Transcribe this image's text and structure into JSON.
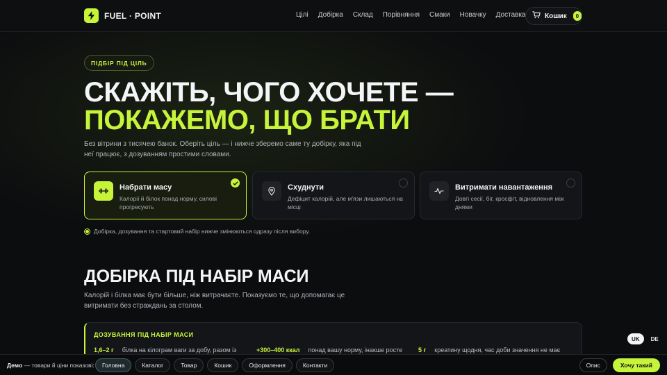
{
  "header": {
    "logo": "FUEL · POINT",
    "nav": [
      "Цілі",
      "Добірка",
      "Склад",
      "Порівняння",
      "Смаки",
      "Новачку",
      "Доставка"
    ],
    "cart_label": "Кошик",
    "cart_count": "0"
  },
  "hero": {
    "pill": "ПІДБІР ПІД ЦІЛЬ",
    "title_line1": "СКАЖІТЬ, ЧОГО ХОЧЕТЕ —",
    "title_line2": "ПОКАЖЕМО, ЩО БРАТИ",
    "lead": "Без вітрини з тисячею банок. Оберіть ціль — і нижче зберемо саме ту добірку, яка під неї працює, з дозуванням простими словами."
  },
  "goals": [
    {
      "title": "Набрати масу",
      "desc": "Калорії й білок понад норму, силові прогресують",
      "icon": "dumbbell-icon",
      "selected": true
    },
    {
      "title": "Схуднути",
      "desc": "Дефіцит калорій, але м'язи лишаються на місці",
      "icon": "location-pin-icon",
      "selected": false
    },
    {
      "title": "Витримати навантаження",
      "desc": "Довгі сесії, біг, кросфіт, відновлення між днями",
      "icon": "pulse-icon",
      "selected": false
    }
  ],
  "note": "Добірка, дозування та стартовий набір нижче змінюються одразу після вибору.",
  "section": {
    "title": "ДОБІРКА ПІД НАБІР МАСИ",
    "subtitle": "Калорій і білка має бути більше, ніж витрачаєте. Показуємо те, що допомагає це витримати без страждань за столом."
  },
  "dosage": {
    "title": "ДОЗУВАННЯ ПІД НАБІР МАСИ",
    "items": [
      {
        "value": "1,6–2 г",
        "text": "білка на кілограм ваги за добу, разом із"
      },
      {
        "value": "+300–400 ккал",
        "text": "понад вашу норму, інакше росте"
      },
      {
        "value": "5 г",
        "text": "креатину щодня, час доби значення не має"
      }
    ]
  },
  "lang": {
    "active": "UK",
    "other": "DE"
  },
  "demo": {
    "label_bold": "Демо",
    "label_rest": " — товари й ціни показові:",
    "chips": [
      "Головна",
      "Каталог",
      "Товар",
      "Кошик",
      "Оформлення",
      "Контакти"
    ],
    "describe": "Опис",
    "cta": "Хочу такий"
  },
  "colors": {
    "accent": "#c6f43a",
    "background": "#0c0d0f",
    "card": "#141518"
  }
}
